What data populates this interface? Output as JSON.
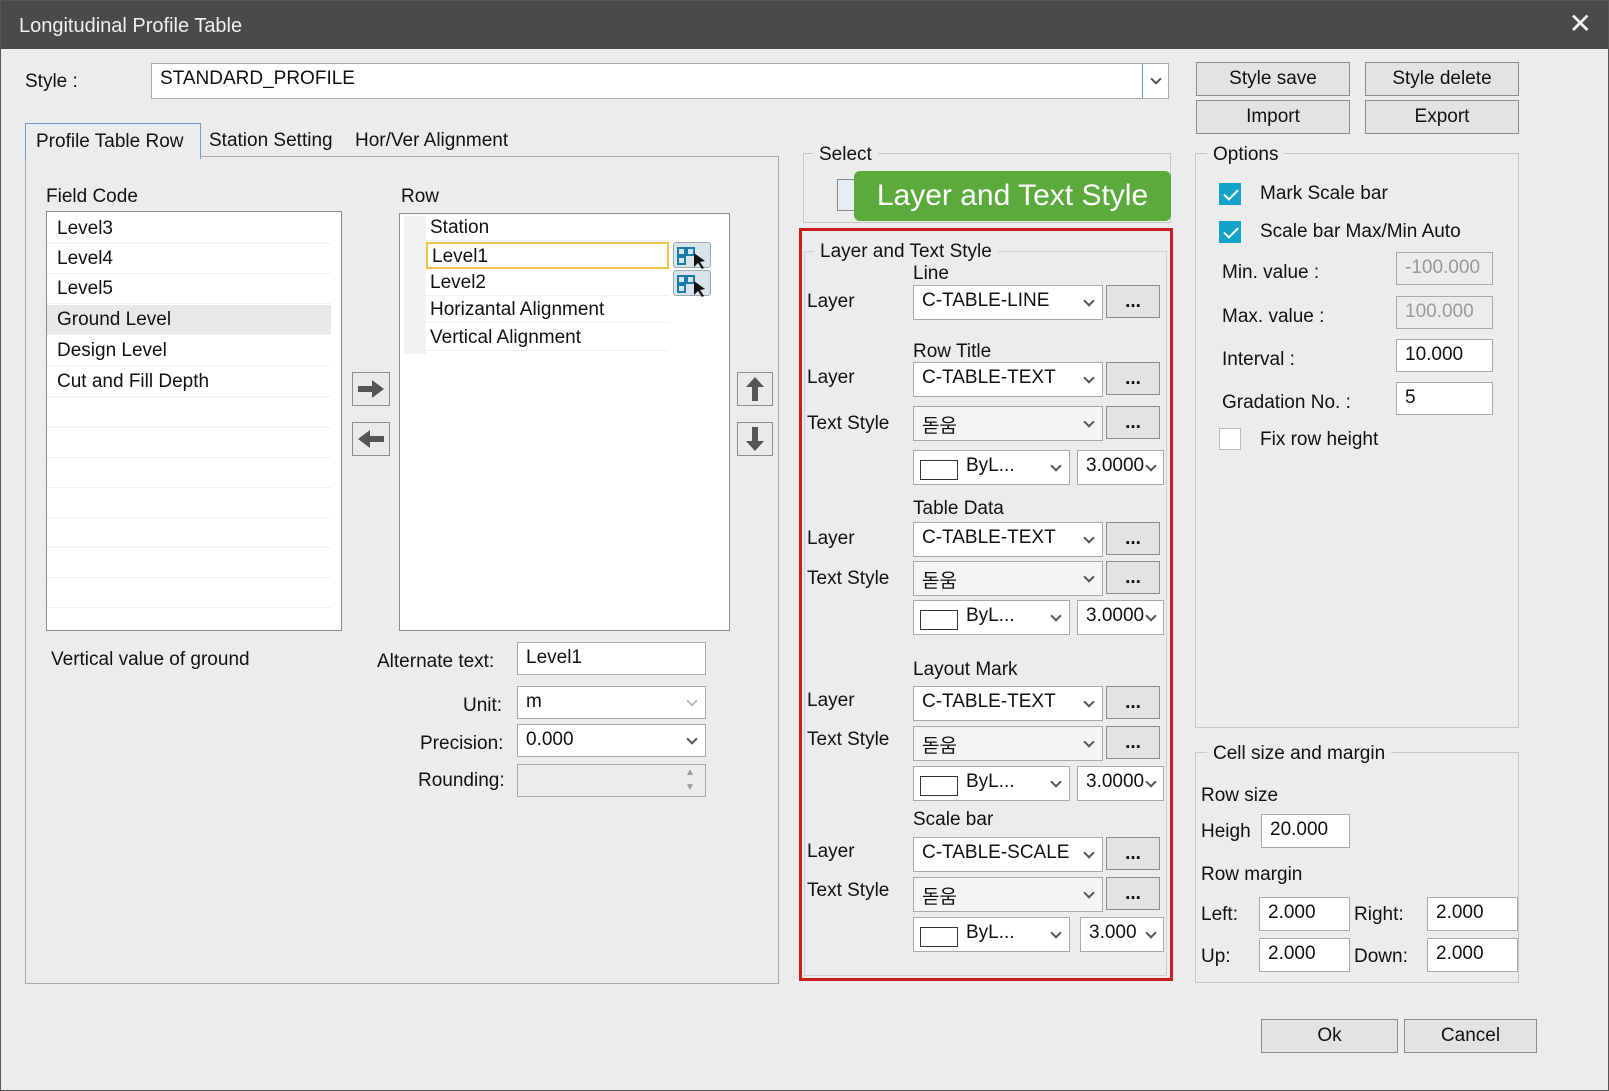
{
  "window": {
    "title": "Longitudinal Profile Table",
    "close": "✕"
  },
  "style": {
    "label": "Style :",
    "value": "STANDARD_PROFILE"
  },
  "top_buttons": {
    "save": "Style save",
    "delete": "Style delete",
    "import": "Import",
    "export": "Export"
  },
  "tabs": [
    "Profile Table Row",
    "Station Setting",
    "Hor/Ver Alignment"
  ],
  "field_code": {
    "label": "Field Code",
    "items": [
      "Level3",
      "Level4",
      "Level5",
      "Ground Level",
      "Design Level",
      "Cut and Fill Depth"
    ],
    "selected": "Ground Level",
    "description": "Vertical value of ground"
  },
  "row": {
    "label": "Row",
    "items": [
      "Station",
      "Level1",
      "Level2",
      "Horizantal Alignment",
      "Vertical Alignment"
    ],
    "selected": "Level1"
  },
  "row_props": {
    "alt_text_label": "Alternate text:",
    "alt_text_value": "Level1",
    "unit_label": "Unit:",
    "unit_value": "m",
    "precision_label": "Precision:",
    "precision_value": "0.000",
    "rounding_label": "Rounding:",
    "rounding_value": ""
  },
  "select": {
    "label": "Select"
  },
  "tooltip": {
    "text": "Layer and Text Style",
    "color": "#5aab3c"
  },
  "highlight_color": "#c81e1e",
  "lts": {
    "title": "Layer and Text Style",
    "layer_label": "Layer",
    "text_style_label": "Text Style",
    "browse": "...",
    "line": {
      "heading": "Line",
      "layer": "C-TABLE-LINE"
    },
    "row_title": {
      "heading": "Row Title",
      "layer": "C-TABLE-TEXT",
      "text_style": "돋움",
      "color": "ByL...",
      "height": "3.0000"
    },
    "table_data": {
      "heading": "Table Data",
      "layer": "C-TABLE-TEXT",
      "text_style": "돋움",
      "color": "ByL...",
      "height": "3.0000"
    },
    "layout_mark": {
      "heading": "Layout Mark",
      "layer": "C-TABLE-TEXT",
      "text_style": "돋움",
      "color": "ByL...",
      "height": "3.0000"
    },
    "scale_bar": {
      "heading": "Scale bar",
      "layer": "C-TABLE-SCALE",
      "text_style": "돋움",
      "color": "ByL...",
      "height": "3.000"
    }
  },
  "options": {
    "title": "Options",
    "mark_scale_bar": "Mark Scale bar",
    "scale_auto": "Scale bar Max/Min Auto",
    "min_label": "Min. value :",
    "min_value": "-100.000",
    "max_label": "Max. value :",
    "max_value": "100.000",
    "interval_label": "Interval :",
    "interval_value": "10.000",
    "gradation_label": "Gradation No. :",
    "gradation_value": "5",
    "fix_row_height": "Fix row height"
  },
  "cell": {
    "title": "Cell size and margin",
    "row_size": "Row size",
    "height_label": "Heigh",
    "height_value": "20.000",
    "row_margin": "Row margin",
    "left_label": "Left:",
    "left_value": "2.000",
    "right_label": "Right:",
    "right_value": "2.000",
    "up_label": "Up:",
    "up_value": "2.000",
    "down_label": "Down:",
    "down_value": "2.000"
  },
  "footer": {
    "ok": "Ok",
    "cancel": "Cancel"
  }
}
